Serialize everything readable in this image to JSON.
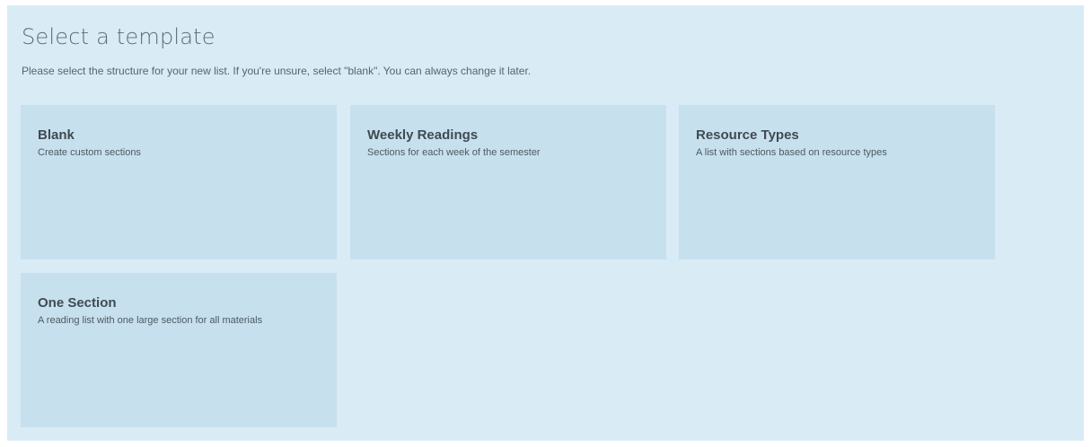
{
  "header": {
    "title": "Select a template",
    "subtitle": "Please select the structure for your new list. If you're unsure, select \"blank\". You can always change it later."
  },
  "templates": [
    {
      "title": "Blank",
      "description": "Create custom sections"
    },
    {
      "title": "Weekly Readings",
      "description": "Sections for each week of the semester"
    },
    {
      "title": "Resource Types",
      "description": "A list with sections based on resource types"
    },
    {
      "title": "One Section",
      "description": "A reading list with one large section for all materials"
    }
  ],
  "colors": {
    "panel_background": "#d9ebf5",
    "card_background": "#c7e0ee",
    "title_text": "#5a6b74",
    "card_title_text": "#3f4b52"
  }
}
